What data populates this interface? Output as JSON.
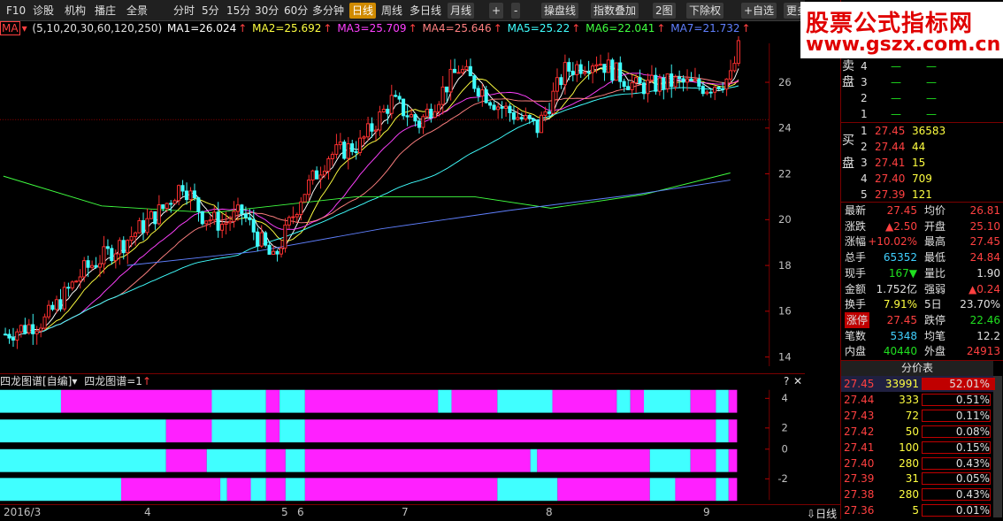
{
  "toolbar": {
    "items": [
      "F10",
      "诊股",
      "机构",
      "播庄",
      "全景",
      "分时",
      "5分",
      "15分",
      "30分",
      "60分",
      "多分钟",
      "日线",
      "周线",
      "多日线",
      "月线",
      "+",
      "-",
      "操盘线",
      "指数叠加",
      "2图",
      "下除权",
      "+自选",
      "更多"
    ]
  },
  "ma_bar": {
    "label": "MA",
    "params": "(5,10,20,30,60,120,250)",
    "ma1": "MA1=26.024",
    "ma2": "MA2=25.692",
    "ma3": "MA3=25.709",
    "ma4": "MA4=25.646",
    "ma5": "MA5=25.22",
    "ma6": "MA6=22.041",
    "ma7": "MA7=21.732",
    "ma1_color": "#ffffff",
    "ma2_color": "#ffff40",
    "ma3_color": "#ff40ff",
    "ma4_color": "#ff8080",
    "ma5_color": "#40ffff",
    "ma6_color": "#40ff40",
    "ma7_color": "#6080ff"
  },
  "main_chart": {
    "y_ticks": [
      "26",
      "24",
      "22",
      "20",
      "18",
      "16",
      "14"
    ],
    "y_values": [
      26,
      24,
      22,
      20,
      18,
      16,
      14
    ],
    "y_range": [
      13.6,
      27.7
    ]
  },
  "sub_chart": {
    "title": "四龙图谱[自编]",
    "formula": "四龙图谱=1",
    "y_ticks": [
      "4",
      "2",
      "0",
      "-2"
    ],
    "colors": {
      "cyan": "#40ffff",
      "magenta": "#ff20ff"
    },
    "rows": [
      [
        [
          "c",
          0,
          72
        ],
        [
          "m",
          72,
          250
        ],
        [
          "c",
          250,
          314
        ],
        [
          "m",
          314,
          330
        ],
        [
          "c",
          330,
          360
        ],
        [
          "m",
          360,
          517
        ],
        [
          "c",
          517,
          533
        ],
        [
          "m",
          533,
          587
        ],
        [
          "c",
          587,
          652
        ],
        [
          "m",
          652,
          728
        ],
        [
          "c",
          728,
          744
        ],
        [
          "m",
          744,
          760
        ],
        [
          "c",
          760,
          815
        ],
        [
          "m",
          815,
          845
        ],
        [
          "c",
          845,
          860
        ],
        [
          "m",
          860,
          870
        ]
      ],
      [
        [
          "c",
          0,
          196
        ],
        [
          "m",
          196,
          250
        ],
        [
          "c",
          250,
          314
        ],
        [
          "m",
          314,
          330
        ],
        [
          "c",
          330,
          360
        ],
        [
          "m",
          360,
          845
        ],
        [
          "c",
          845,
          860
        ],
        [
          "m",
          860,
          870
        ]
      ],
      [
        [
          "c",
          0,
          196
        ],
        [
          "m",
          196,
          244
        ],
        [
          "c",
          244,
          314
        ],
        [
          "m",
          314,
          337
        ],
        [
          "c",
          337,
          360
        ],
        [
          "m",
          360,
          626
        ],
        [
          "c",
          626,
          634
        ],
        [
          "m",
          634,
          767
        ],
        [
          "c",
          767,
          815
        ],
        [
          "m",
          815,
          845
        ],
        [
          "c",
          845,
          860
        ],
        [
          "m",
          860,
          870
        ]
      ],
      [
        [
          "c",
          0,
          143
        ],
        [
          "m",
          143,
          260
        ],
        [
          "c",
          260,
          268
        ],
        [
          "m",
          268,
          296
        ],
        [
          "c",
          296,
          314
        ],
        [
          "m",
          314,
          337
        ],
        [
          "c",
          337,
          360
        ],
        [
          "m",
          360,
          587
        ],
        [
          "c",
          587,
          658
        ],
        [
          "m",
          658,
          767
        ],
        [
          "c",
          767,
          797
        ],
        [
          "m",
          797,
          845
        ],
        [
          "c",
          845,
          860
        ],
        [
          "m",
          860,
          870
        ]
      ]
    ]
  },
  "x_axis": {
    "labels": [
      "2016/3",
      "4",
      "5",
      "6",
      "7",
      "8",
      "9"
    ],
    "dropdown": "日线"
  },
  "watermark": {
    "line1": "股票公式指标网",
    "line2": "www.gszx.com.cn"
  },
  "order_book": {
    "sell_label": "卖盘",
    "buy_label": "买盘",
    "sells": [
      {
        "lvl": "4",
        "price": "—",
        "vol": "—"
      },
      {
        "lvl": "3",
        "price": "—",
        "vol": "—"
      },
      {
        "lvl": "2",
        "price": "—",
        "vol": "—"
      },
      {
        "lvl": "1",
        "price": "—",
        "vol": "—"
      }
    ],
    "buys": [
      {
        "lvl": "1",
        "price": "27.45",
        "vol": "36583"
      },
      {
        "lvl": "2",
        "price": "27.44",
        "vol": "44"
      },
      {
        "lvl": "3",
        "price": "27.41",
        "vol": "15"
      },
      {
        "lvl": "4",
        "price": "27.40",
        "vol": "709"
      },
      {
        "lvl": "5",
        "price": "27.39",
        "vol": "121"
      }
    ]
  },
  "quote": [
    {
      "k1": "最新",
      "v1": "27.45",
      "k2": "均价",
      "v2": "26.81",
      "c1": "red",
      "c2": "red"
    },
    {
      "k1": "涨跌",
      "v1": "▲2.50",
      "k2": "开盘",
      "v2": "25.10",
      "c1": "red",
      "c2": "red"
    },
    {
      "k1": "涨幅",
      "v1": "+10.02%",
      "k2": "最高",
      "v2": "27.45",
      "c1": "red",
      "c2": "red"
    },
    {
      "k1": "总手",
      "v1": "65352",
      "k2": "最低",
      "v2": "24.84",
      "c1": "cyan",
      "c2": "red"
    },
    {
      "k1": "现手",
      "v1": "167▼",
      "k2": "量比",
      "v2": "1.90",
      "c1": "green",
      "c2": "white"
    },
    {
      "k1": "金额",
      "v1": "1.752亿",
      "k2": "强弱",
      "v2": "▲0.24",
      "c1": "white",
      "c2": "red"
    },
    {
      "k1": "换手",
      "v1": "7.91%",
      "k2": "5日",
      "v2": "23.70%",
      "c1": "yellow",
      "c2": "white"
    },
    {
      "k1": "涨停",
      "v1": "27.45",
      "k2": "跌停",
      "v2": "22.46",
      "c1": "red",
      "c2": "green"
    },
    {
      "k1": "笔数",
      "v1": "5348",
      "k2": "均笔",
      "v2": "12.2",
      "c1": "cyan",
      "c2": "white"
    },
    {
      "k1": "内盘",
      "v1": "40440",
      "k2": "外盘",
      "v2": "24913",
      "c1": "green",
      "c2": "red"
    }
  ],
  "price_dist": {
    "title": "分价表",
    "rows": [
      {
        "price": "27.45",
        "vol": "33991",
        "pct": "52.01%",
        "frac": 0.52
      },
      {
        "price": "27.44",
        "vol": "333",
        "pct": "0.51%",
        "frac": 0.005
      },
      {
        "price": "27.43",
        "vol": "72",
        "pct": "0.11%",
        "frac": 0.001
      },
      {
        "price": "27.42",
        "vol": "50",
        "pct": "0.08%",
        "frac": 0.001
      },
      {
        "price": "27.41",
        "vol": "100",
        "pct": "0.15%",
        "frac": 0.002
      },
      {
        "price": "27.40",
        "vol": "280",
        "pct": "0.43%",
        "frac": 0.004
      },
      {
        "price": "27.39",
        "vol": "31",
        "pct": "0.05%",
        "frac": 0.0005
      },
      {
        "price": "27.38",
        "vol": "280",
        "pct": "0.43%",
        "frac": 0.004
      },
      {
        "price": "27.36",
        "vol": "5",
        "pct": "0.01%",
        "frac": 0.0001
      }
    ]
  }
}
